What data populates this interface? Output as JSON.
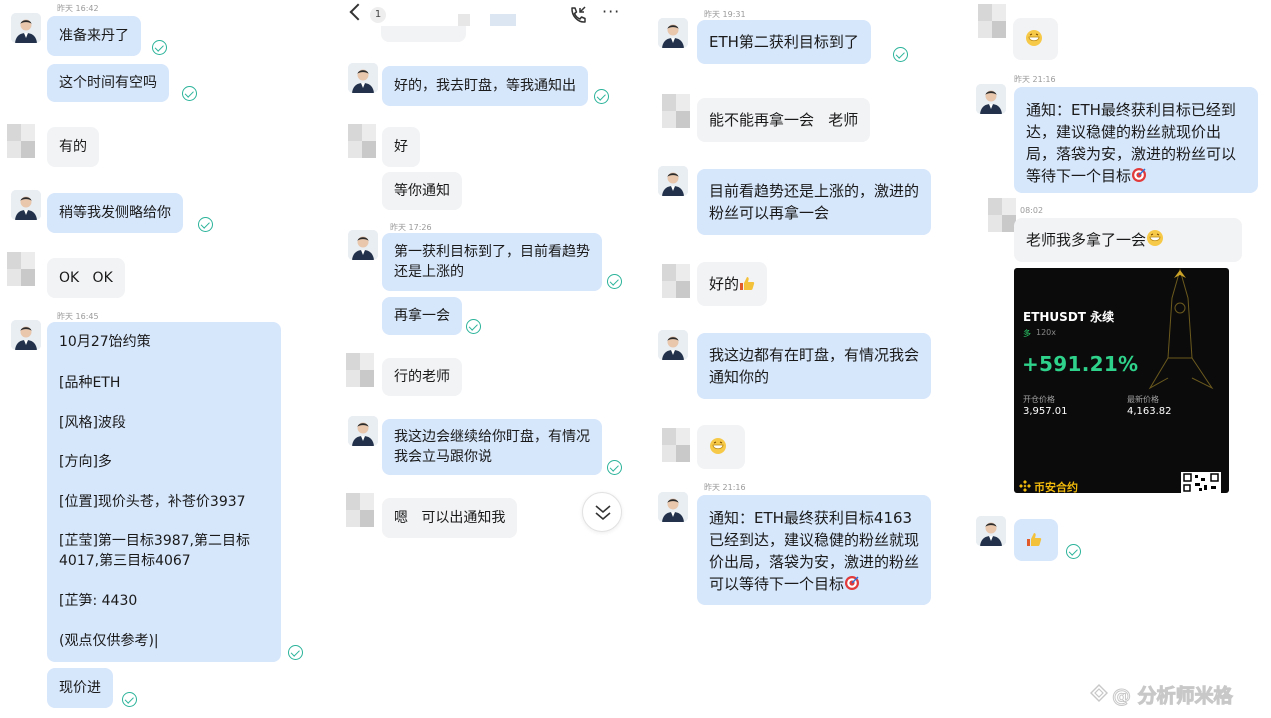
{
  "panel1": {
    "time_top": "昨天 16:42",
    "time_mid": "昨天 16:45",
    "messages": [
      "准备来丹了",
      "这个时间有空吗",
      "有的",
      "稍等我发侧略给你",
      "OK   OK",
      "现价进"
    ],
    "strategy_lines": [
      "10月27饴约策",
      "[品种ETH",
      "[风格]波段",
      "[方向]多",
      "[位置]现价头苍，补苍价3937",
      "[芷莹]第一目标3987,第二目标",
      "4017,第三目标4067",
      "[芷笋: 4430",
      "(观点仅供参考)|"
    ]
  },
  "panel2": {
    "header": {
      "unread_count": "1"
    },
    "time_mid": "昨天 17:26",
    "messages": [
      "好的，我去盯盘，等我通知出",
      "好",
      "等你通知",
      "第一获利目标到了，目前看趋势",
      "还是上涨的",
      "再拿一会",
      "行的老师",
      "我这边会继续给你盯盘，有情况",
      "我会立马跟你说",
      "嗯   可以出通知我"
    ]
  },
  "panel3": {
    "time_top": "昨天 19:31",
    "time_mid": "昨天 21:16",
    "messages": [
      "ETH第二获利目标到了",
      "能不能再拿一会   老师",
      "目前看趋势还是上涨的，激进的",
      "粉丝可以再拿一会",
      "好的",
      "我这边都有在盯盘，有情况我会",
      "通知你的"
    ],
    "final_lines": [
      "通知：ETH最终获利目标4163",
      "已经到达，建议稳健的粉丝就现",
      "价出局，落袋为安，激进的粉丝",
      "可以等待下一个目标"
    ]
  },
  "panel4": {
    "time_a": "昨天 21:16",
    "time_b": "08:02",
    "notice_lines": [
      "通知：ETH最终获利目标已经到",
      "达，建议稳健的粉丝就现价出",
      "局，落袋为安，激进的粉丝可以",
      "等待下一个目标"
    ],
    "reply": "老师我多拿了一会",
    "card": {
      "title": "ETHUSDT 永续",
      "side": "多",
      "leverage": "120x",
      "pnl": "+591.21%",
      "entry_label": "开仓价格",
      "entry_value": "3,957.01",
      "last_label": "最新价格",
      "last_value": "4,163.82",
      "brand": "币安合约"
    }
  },
  "watermark": "@ 分析师米格",
  "colors": {
    "own_bubble": "#d6e6fb",
    "other_bubble": "#f2f3f5",
    "read_check": "#2bb39a",
    "profit_green": "#2fd28a",
    "binance_yellow": "#f0b90b"
  }
}
